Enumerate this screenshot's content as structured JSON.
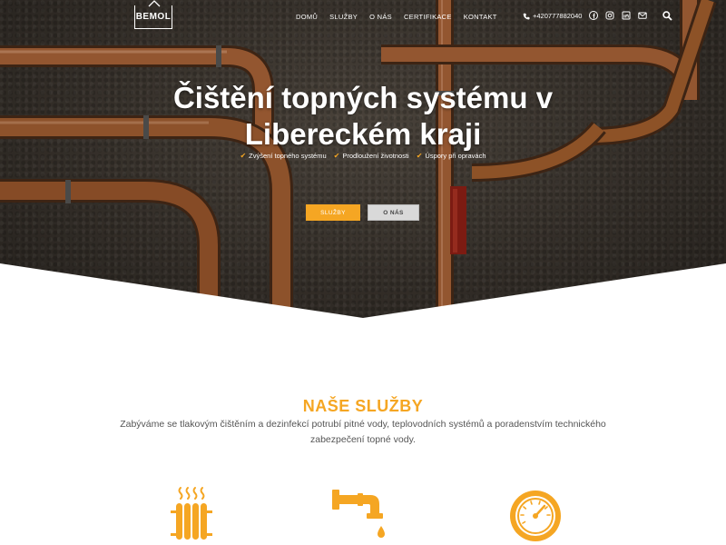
{
  "nav": {
    "logo_text": "BEMOL",
    "menu": [
      "DOMŮ",
      "SLUŽBY",
      "O NÁS",
      "CERTIFIKACE",
      "KONTAKT"
    ],
    "phone": "+420777882040",
    "social_icons": [
      "facebook-icon",
      "instagram-icon",
      "linkedin-icon",
      "email-icon"
    ],
    "search_icon": "search-icon"
  },
  "hero": {
    "title_line1": "Čištění topných systému v",
    "title_line2": "Libereckém kraji",
    "checks": [
      "Zvýšení topného systému",
      "Prodloužení životnosti",
      "Úspory při opravách"
    ],
    "btn_services": "SLUŽBY",
    "btn_about": "O NÁS"
  },
  "services": {
    "title": "NAŠE SLUŽBY",
    "description": "Zabýváme se tlakovým čištěním a dezinfekcí potrubí pitné vody, teplovodních systémů a poradenstvím technického zabezpečení topné vody.",
    "icons": [
      "radiator-icon",
      "faucet-drip-icon",
      "pressure-gauge-icon"
    ]
  },
  "colors": {
    "accent": "#f5a623",
    "copper": "#b56a3e",
    "text": "#555555"
  }
}
